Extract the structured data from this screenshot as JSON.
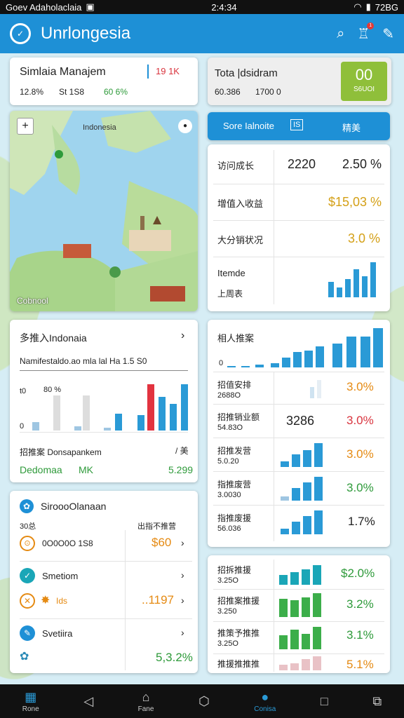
{
  "status": {
    "left": "Goev Adaholaclaia",
    "time": "2:4:34",
    "right": "72BG"
  },
  "app": {
    "title": "Unrlongesia"
  },
  "card_manage": {
    "title": "Simlaia Manajem",
    "badge": "19 1K",
    "v1": "12.8%",
    "v2": "St 1S8",
    "v3": "60 6%"
  },
  "card_total": {
    "title": "Tota |dsidram",
    "v1": "60.386",
    "v2": "1700 0",
    "box_value": "00",
    "box_label": "S6UOI"
  },
  "map": {
    "plus": "+",
    "label_top": "Indonesia",
    "label_bottom": "Cobnool"
  },
  "tab_button": {
    "label": "Sore Ialnoite",
    "chip": "IS",
    "right": "精美"
  },
  "stats1": [
    {
      "label": "访问成长",
      "value": "2220",
      "pct": "2.50 %"
    },
    {
      "label": "增值入收益",
      "pct": "$15,03 %"
    },
    {
      "label": "大分销状况",
      "pct": "3.0 %"
    },
    {
      "label": "Itemde",
      "sub": "上周表"
    }
  ],
  "chart_left": {
    "title": "多推入Indonaia",
    "subtitle": "Namifestaldo.ao mla lal Ha 1.5 S0",
    "ylabel": "t0",
    "ylabel2": "80 %",
    "ylabel3": "0",
    "foot_label": "招推案 Donsapankem",
    "foot_right": "/ 美",
    "foot_name": "Dedomaa",
    "foot_mid": "MK",
    "foot_val": "5.299"
  },
  "right_chart": {
    "title": "相人推案",
    "zero": "0"
  },
  "stats2": [
    {
      "label": "招值安排",
      "sub": "2688O",
      "value": "",
      "pct": "3.0%"
    },
    {
      "label": "招推销业额",
      "sub": "54.83O",
      "value": "3286",
      "pct": "3.0%"
    },
    {
      "label": "招推发营",
      "sub": "5.0.20",
      "pct": "3.0%"
    },
    {
      "label": "指推废营",
      "sub": "3.0030",
      "pct": "3.0%"
    },
    {
      "label": "指推废援",
      "sub": "56.036",
      "pct": "1.7%"
    }
  ],
  "list_left": {
    "header": "SiroooOlanaan",
    "sub_left": "30总",
    "sub_right": "出指不推营",
    "row1_text": "0O0O0O 1S8",
    "row1_val": "$60",
    "row2_label": "Smetiom",
    "row2_text": "Ids",
    "row2_val": "..1197",
    "row3_label": "Svetiira",
    "row3_val": "5,3.2%"
  },
  "stats3": [
    {
      "label": "招拆推援",
      "sub": "3.25O",
      "pct": "$2.0%"
    },
    {
      "label": "招推案推援",
      "sub": "3.250",
      "pct": "3.2%"
    },
    {
      "label": "推策予推推",
      "sub": "3.25O",
      "pct": "3.1%"
    },
    {
      "label": "推援推推推",
      "sub": "",
      "pct": "5.1%"
    }
  ],
  "nav": {
    "home": "Rone",
    "forms": "Fane",
    "active": "Conisa"
  },
  "colors": {
    "primary": "#1e90d6",
    "green": "#2e9a3a",
    "orange": "#e58a12",
    "red": "#d9343e"
  }
}
